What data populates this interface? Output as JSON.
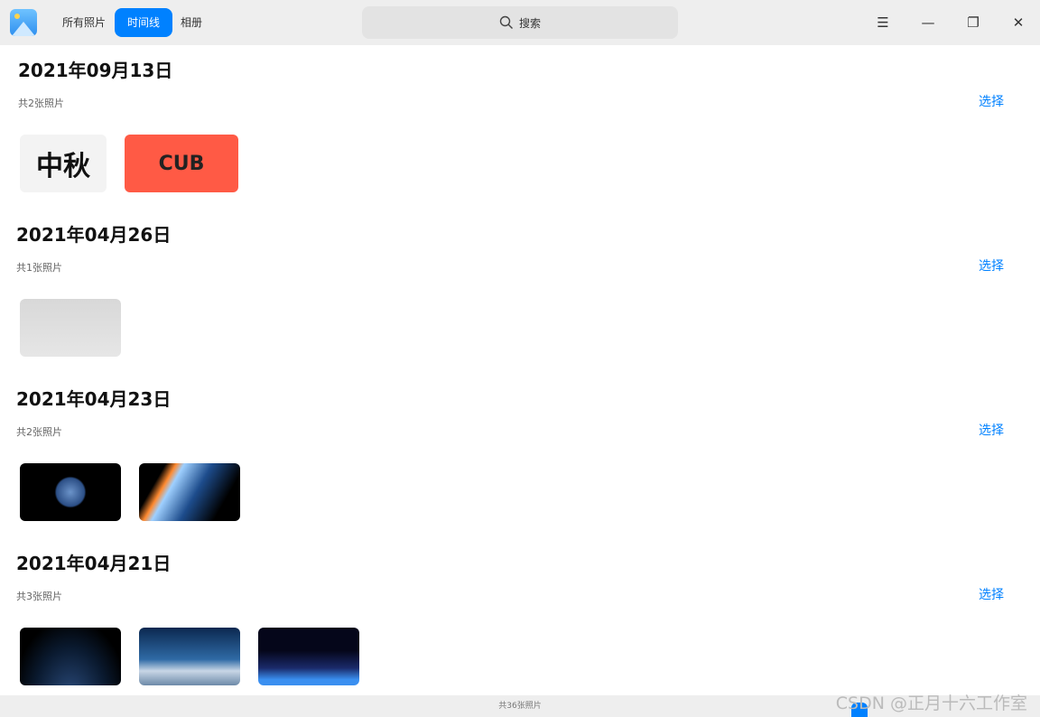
{
  "titlebar": {
    "tabs": [
      {
        "label": "所有照片"
      },
      {
        "label": "时间线"
      },
      {
        "label": "相册"
      }
    ],
    "active_tab": 1,
    "search_placeholder": "搜索"
  },
  "sections": [
    {
      "date": "2021年09月13日",
      "count": "共2张照片",
      "select": "选择",
      "thumbs": [
        "中秋",
        "CUB"
      ]
    },
    {
      "date": "2021年04月26日",
      "count": "共1张照片",
      "select": "选择"
    },
    {
      "date": "2021年04月23日",
      "count": "共2张照片",
      "select": "选择"
    },
    {
      "date": "2021年04月21日",
      "count": "共3张照片",
      "select": "选择"
    }
  ],
  "status": {
    "total": "共36张照片"
  },
  "watermark": "CSDN @正月十六工作室",
  "colors": {
    "accent": "#0081ff",
    "titlebar": "#eeeeee"
  }
}
